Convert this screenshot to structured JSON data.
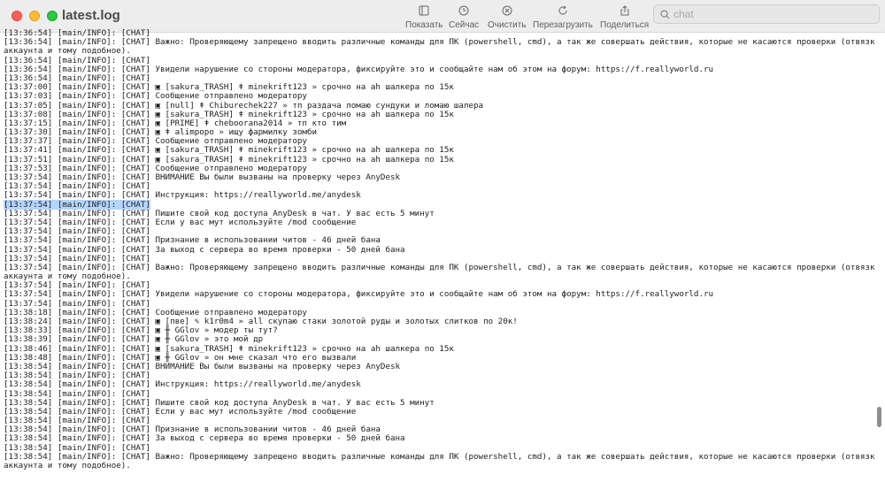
{
  "window": {
    "title": "latest.log"
  },
  "toolbar": {
    "show_label": "Показать",
    "now_label": "Сейчас",
    "clear_label": "Очистить",
    "reload_label": "Перезагрузить",
    "share_label": "Поделиться"
  },
  "search": {
    "placeholder": "chat",
    "value": ""
  },
  "log": {
    "selected_line": 19,
    "lines": [
      "[13:36:54] [main/INFO]: [CHAT]",
      "[13:36:54] [main/INFO]: [CHAT] Важно: Проверяющему запрещено вводить различные команды для ПК (powershell, cmd), а так же совершать действия, которые не касаются проверки (отвязка",
      "аккаунта и тому подобное).",
      "[13:36:54] [main/INFO]: [CHAT]",
      "[13:36:54] [main/INFO]: [CHAT] Увидели нарушение со стороны модератора, фиксируйте это и сообщайте нам об этом на форум: https://f.reallyworld.ru",
      "[13:36:54] [main/INFO]: [CHAT]",
      "[13:37:00] [main/INFO]: [CHAT] ▣ [sakura_TRASH] ǂ minekrift123 » срочно на ah шалкера по 15к",
      "[13:37:03] [main/INFO]: [CHAT] Сообщение отправлено модератору",
      "[13:37:05] [main/INFO]: [CHAT] ▣ [null] ǂ Chiburechek227 » тп раздача ломаю сундуки и ломаю шалера",
      "[13:37:08] [main/INFO]: [CHAT] ▣ [sakura_TRASH] ǂ minekrift123 » срочно на ah шалкера по 15к",
      "[13:37:15] [main/INFO]: [CHAT] ▣ [PRIME] ǂ cheboorana2014 » тп кто тим",
      "[13:37:30] [main/INFO]: [CHAT] ▣ ǂ alimpopo » ищу фармилку зомби",
      "[13:37:37] [main/INFO]: [CHAT] Сообщение отправлено модератору",
      "[13:37:41] [main/INFO]: [CHAT] ▣ [sakura_TRASH] ǂ minekrift123 » срочно на ah шалкера по 15к",
      "[13:37:51] [main/INFO]: [CHAT] ▣ [sakura_TRASH] ǂ minekrift123 » срочно на ah шалкера по 15к",
      "[13:37:53] [main/INFO]: [CHAT] Сообщение отправлено модератору",
      "[13:37:54] [main/INFO]: [CHAT] ВНИМАНИЕ Вы были вызваны на проверку через AnyDesk",
      "[13:37:54] [main/INFO]: [CHAT]",
      "[13:37:54] [main/INFO]: [CHAT] Инструкция: https://reallyworld.me/anydesk",
      "[13:37:54] [main/INFO]: [CHAT]",
      "[13:37:54] [main/INFO]: [CHAT] Пишите свой код доступа AnyDesk в чат. У вас есть 5 минут",
      "[13:37:54] [main/INFO]: [CHAT] Если у вас мут используйте /mod сообщение",
      "[13:37:54] [main/INFO]: [CHAT]",
      "[13:37:54] [main/INFO]: [CHAT] Признание в использовании читов - 46 дней бана",
      "[13:37:54] [main/INFO]: [CHAT] За выход с сервера во время проверки - 50 дней бана",
      "[13:37:54] [main/INFO]: [CHAT]",
      "[13:37:54] [main/INFO]: [CHAT] Важно: Проверяющему запрещено вводить различные команды для ПК (powershell, cmd), а так же совершать действия, которые не касаются проверки (отвязка",
      "аккаунта и тому подобное).",
      "[13:37:54] [main/INFO]: [CHAT]",
      "[13:37:54] [main/INFO]: [CHAT] Увидели нарушение со стороны модератора, фиксируйте это и сообщайте нам об этом на форум: https://f.reallyworld.ru",
      "[13:37:54] [main/INFO]: [CHAT]",
      "[13:38:18] [main/INFO]: [CHAT] Сообщение отправлено модератору",
      "[13:38:24] [main/INFO]: [CHAT] ▣ [пве] ✎ k1r0m4 » all скупаю стаки золотой руды и золотых слитков по 20к!",
      "[13:38:33] [main/INFO]: [CHAT] ▣ ╫ GGlov » модер ты тут?",
      "[13:38:39] [main/INFO]: [CHAT] ▣ ╫ GGlov » это мой др",
      "[13:38:46] [main/INFO]: [CHAT] ▣ [sakura_TRASH] ǂ minekrift123 » срочно на ah шалкера по 15к",
      "[13:38:48] [main/INFO]: [CHAT] ▣ ╫ GGlov » он мне сказал что его вызвали",
      "[13:38:54] [main/INFO]: [CHAT] ВНИМАНИЕ Вы были вызваны на проверку через AnyDesk",
      "[13:38:54] [main/INFO]: [CHAT]",
      "[13:38:54] [main/INFO]: [CHAT] Инструкция: https://reallyworld.me/anydesk",
      "[13:38:54] [main/INFO]: [CHAT]",
      "[13:38:54] [main/INFO]: [CHAT] Пишите свой код доступа AnyDesk в чат. У вас есть 5 минут",
      "[13:38:54] [main/INFO]: [CHAT] Если у вас мут используйте /mod сообщение",
      "[13:38:54] [main/INFO]: [CHAT]",
      "[13:38:54] [main/INFO]: [CHAT] Признание в использовании читов - 46 дней бана",
      "[13:38:54] [main/INFO]: [CHAT] За выход с сервера во время проверки - 50 дней бана",
      "[13:38:54] [main/INFO]: [CHAT]",
      "[13:38:54] [main/INFO]: [CHAT] Важно: Проверяющему запрещено вводить различные команды для ПК (powershell, cmd), а так же совершать действия, которые не касаются проверки (отвязка",
      "аккаунта и тому подобное)."
    ]
  }
}
